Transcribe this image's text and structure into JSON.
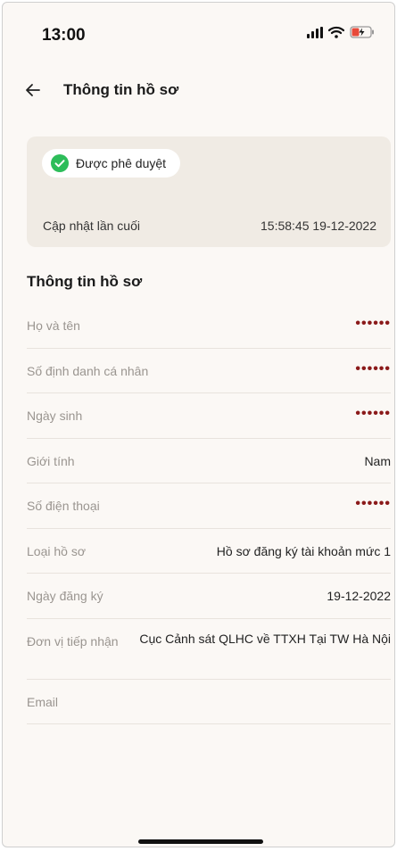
{
  "status_bar": {
    "time": "13:00"
  },
  "header": {
    "title": "Thông tin hồ sơ"
  },
  "status_card": {
    "status_label": "Được phê duyệt",
    "updated_label": "Cập nhật lần cuối",
    "updated_value": "15:58:45 19-12-2022"
  },
  "section": {
    "title": "Thông tin hồ sơ"
  },
  "rows": [
    {
      "label": "Họ và tên",
      "value": "••••••"
    },
    {
      "label": "Số định danh cá nhân",
      "value": "••••••"
    },
    {
      "label": "Ngày sinh",
      "value": "••••••"
    },
    {
      "label": "Giới tính",
      "value": "Nam"
    },
    {
      "label": "Số điện thoại",
      "value": "••••••"
    },
    {
      "label": "Loại hồ sơ",
      "value": "Hồ sơ đăng ký tài khoản mức 1"
    },
    {
      "label": "Ngày đăng ký",
      "value": "19-12-2022"
    },
    {
      "label": "Đơn vị tiếp nhận",
      "value": "Cục Cảnh sát QLHC về TTXH Tại TW Hà Nội"
    },
    {
      "label": "Email",
      "value": ""
    }
  ],
  "colors": {
    "accent_green": "#2dbd5a",
    "masked_red": "#8b1a1a",
    "card_bg": "#f0ebe4"
  },
  "icons": {
    "back": "arrow-left-icon",
    "status": "check-circle-icon"
  }
}
